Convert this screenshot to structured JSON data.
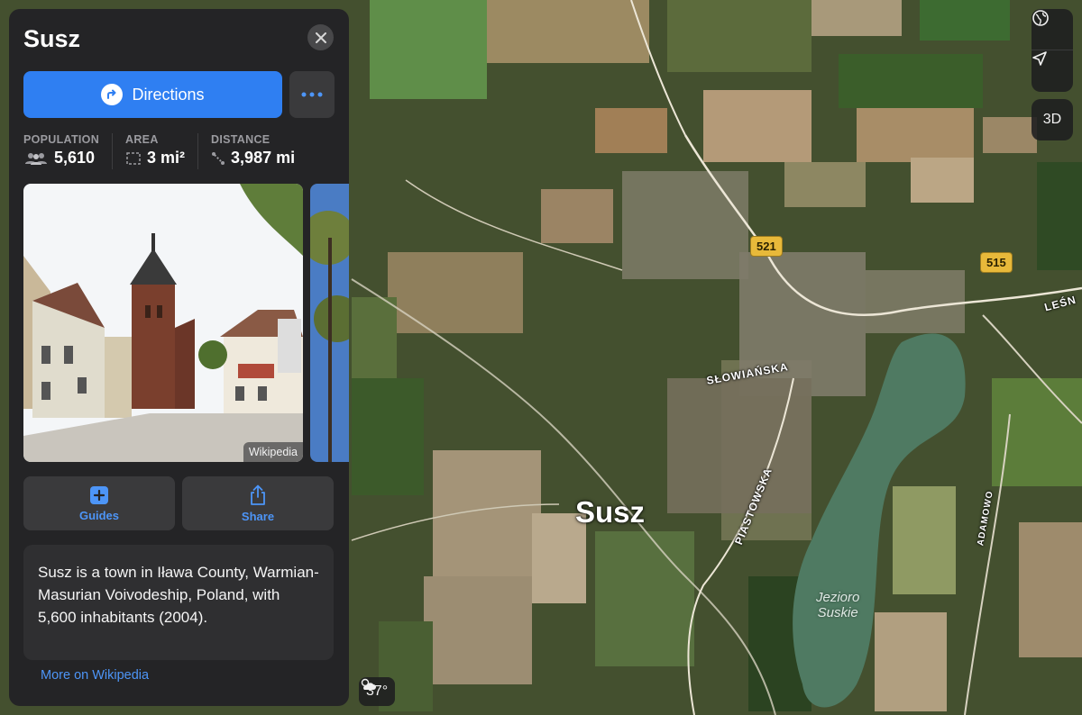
{
  "place": {
    "title": "Susz",
    "directions_label": "Directions",
    "stats": [
      {
        "label": "POPULATION",
        "value": "5,610",
        "icon": "people-icon"
      },
      {
        "label": "AREA",
        "value": "3 mi²",
        "icon": "area-icon"
      },
      {
        "label": "DISTANCE",
        "value": "3,987 mi",
        "icon": "route-icon"
      }
    ],
    "photo_credit": "Wikipedia",
    "actions": {
      "guides_label": "Guides",
      "share_label": "Share"
    },
    "description": "Susz is a town in Iława County, Warmian-Masurian Voivodeship, Poland, with 5,600 inhabitants (2004).",
    "more_link": "More on Wikipedia"
  },
  "map": {
    "city_label": "Susz",
    "road_shields": [
      "521",
      "515"
    ],
    "streets": [
      "SŁOWIAŃSKA",
      "PIASTOWSKA",
      "ADAMOWO",
      "LEŚN"
    ],
    "lake_label_line1": "Jezioro",
    "lake_label_line2": "Suskie",
    "controls": {
      "globe_icon": "globe-icon",
      "location_icon": "location-arrow-icon",
      "three_d_label": "3D"
    },
    "weather": {
      "temperature": "37°",
      "icon": "partly-cloudy-icon"
    }
  },
  "colors": {
    "accent": "#2f7ff2",
    "link": "#4d95f7",
    "panel": "#242426",
    "lake": "#4f7a62"
  }
}
